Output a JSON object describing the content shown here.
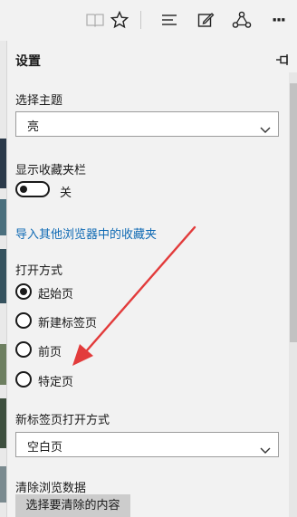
{
  "browser": {
    "toolbar_icons": [
      "reading-view-icon",
      "favorite-star-icon",
      "hub-icon",
      "notes-icon",
      "share-icon",
      "more-icon"
    ],
    "more_glyph": "···"
  },
  "settings": {
    "title": "设置",
    "theme": {
      "label": "选择主题",
      "value": "亮"
    },
    "favorites_bar": {
      "label": "显示收藏夹栏",
      "toggle_state": "关"
    },
    "import_link": "导入其他浏览器中的收藏夹",
    "open_with": {
      "label": "打开方式",
      "options": [
        "起始页",
        "新建标签页",
        "前页",
        "特定页"
      ],
      "selected": "起始页"
    },
    "new_tab": {
      "label": "新标签页打开方式",
      "value": "空白页"
    },
    "clear_data": {
      "label": "清除浏览数据",
      "button": "选择要清除的内容"
    }
  },
  "colors": {
    "link": "#0f6ab4",
    "annotation_arrow": "#e23b3b",
    "panel_bg": "#f2f2f2"
  }
}
